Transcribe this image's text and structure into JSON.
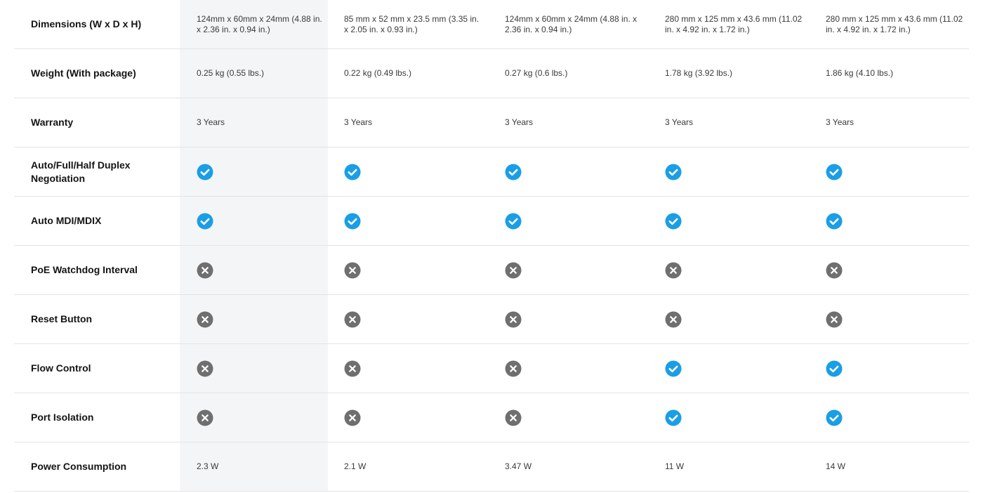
{
  "columns_count": 5,
  "rows": [
    {
      "label": "Dimensions (W x D x H)",
      "type": "text",
      "values": [
        "124mm x 60mm x 24mm (4.88 in. x 2.36 in. x 0.94 in.)",
        "85 mm x 52 mm x 23.5 mm (3.35 in. x 2.05 in. x 0.93 in.)",
        "124mm x 60mm x 24mm (4.88 in. x 2.36 in. x 0.94 in.)",
        "280 mm x 125 mm x 43.6 mm (11.02 in. x 4.92 in. x 1.72 in.)",
        "280 mm x 125 mm x 43.6 mm (11.02 in. x 4.92 in. x 1.72 in.)"
      ]
    },
    {
      "label": "Weight (With package)",
      "type": "text",
      "values": [
        "0.25 kg (0.55 lbs.)",
        "0.22 kg (0.49 lbs.)",
        "0.27 kg (0.6 lbs.)",
        "1.78 kg (3.92 lbs.)",
        "1.86 kg (4.10 lbs.)"
      ]
    },
    {
      "label": "Warranty",
      "type": "text",
      "values": [
        "3 Years",
        "3 Years",
        "3 Years",
        "3 Years",
        "3 Years"
      ]
    },
    {
      "label": "Auto/Full/Half Duplex Negotiation",
      "type": "icon",
      "values": [
        "check-icon",
        "check-icon",
        "check-icon",
        "check-icon",
        "check-icon"
      ]
    },
    {
      "label": "Auto MDI/MDIX",
      "type": "icon",
      "values": [
        "check-icon",
        "check-icon",
        "check-icon",
        "check-icon",
        "check-icon"
      ]
    },
    {
      "label": "PoE Watchdog Interval",
      "type": "icon",
      "values": [
        "cross-icon",
        "cross-icon",
        "cross-icon",
        "cross-icon",
        "cross-icon"
      ]
    },
    {
      "label": "Reset Button",
      "type": "icon",
      "values": [
        "cross-icon",
        "cross-icon",
        "cross-icon",
        "cross-icon",
        "cross-icon"
      ]
    },
    {
      "label": "Flow Control",
      "type": "icon",
      "values": [
        "cross-icon",
        "cross-icon",
        "cross-icon",
        "check-icon",
        "check-icon"
      ]
    },
    {
      "label": "Port Isolation",
      "type": "icon",
      "values": [
        "cross-icon",
        "cross-icon",
        "cross-icon",
        "check-icon",
        "check-icon"
      ]
    },
    {
      "label": "Power Consumption",
      "type": "text",
      "values": [
        "2.3 W",
        "2.1 W",
        "3.47 W",
        "11 W",
        "14 W"
      ]
    }
  ],
  "colors": {
    "check": "#1a9ee6",
    "cross": "#6f6f6f",
    "highlight_column": "#f4f5f7",
    "divider": "#e3e4e6"
  }
}
